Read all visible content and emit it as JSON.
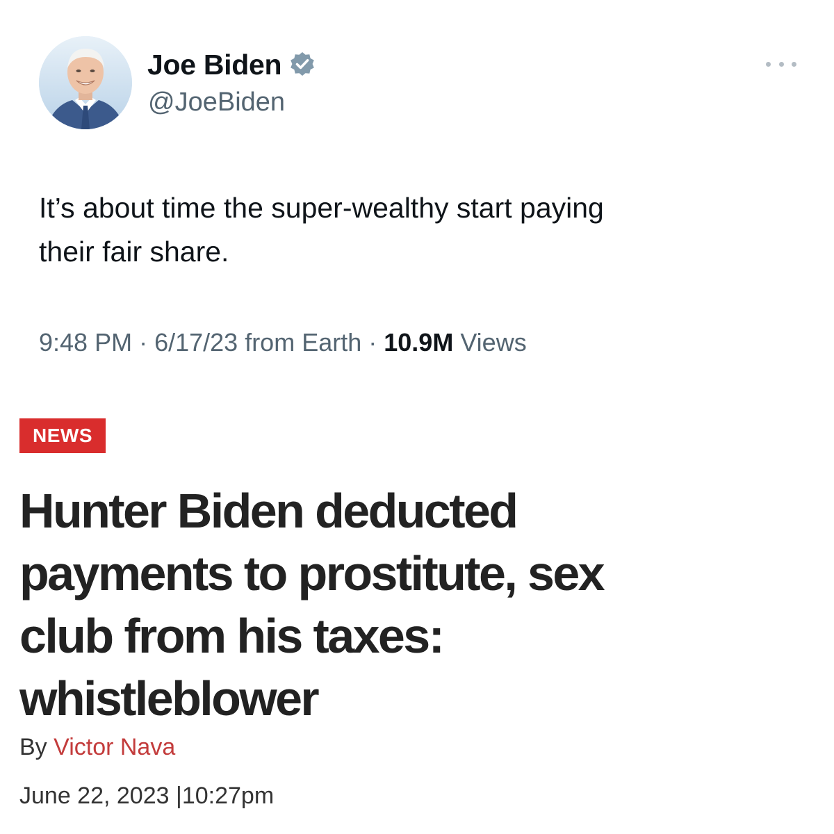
{
  "tweet": {
    "author": {
      "name": "Joe Biden",
      "handle": "@JoeBiden",
      "verified": true,
      "badge_color": "#829aab"
    },
    "text_lines": [
      "It’s about time the super-wealthy start paying",
      "their fair share."
    ],
    "meta": {
      "time": "9:48 PM",
      "separator": "·",
      "date_source": "6/17/23 from Earth",
      "views_count": "10.9M",
      "views_label": "Views"
    },
    "icons": {
      "more": "more-horizontal-icon",
      "verified": "verified-badge-icon",
      "avatar": "profile-photo"
    }
  },
  "article": {
    "badge": "NEWS",
    "badge_color": "#d92d2d",
    "headline_lines": [
      "Hunter Biden deducted",
      "payments to prostitute, sex",
      "club from his taxes:",
      "whistleblower"
    ],
    "byline_prefix": "By",
    "author": "Victor Nava",
    "author_color": "#c33c3c",
    "date": "June 22, 2023",
    "date_separator": "|",
    "time": "10:27pm"
  }
}
